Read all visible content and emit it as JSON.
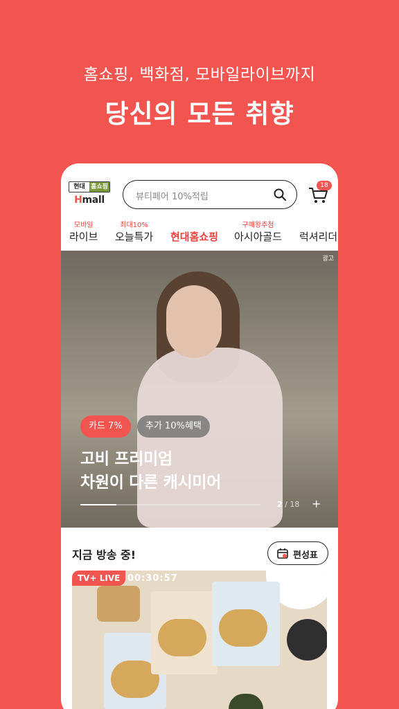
{
  "promo": {
    "subtitle": "홈쇼핑, 백화점, 모바일라이브까지",
    "title": "당신의 모든 취향"
  },
  "header": {
    "logo_top_left": "현대",
    "logo_top_right": "홈쇼핑",
    "logo_h": "H",
    "logo_mall": "mall",
    "search_placeholder": "뷰티페어 10%적립",
    "cart_count": "18"
  },
  "tabs": [
    {
      "sup": "모바일",
      "label": "라이브"
    },
    {
      "sup": "최대10%",
      "label": "오늘특가"
    },
    {
      "sup": "",
      "label": "현대홈쇼핑"
    },
    {
      "sup": "구매왕추첨",
      "label": "아시아골드"
    },
    {
      "sup": "",
      "label": "럭셔리더"
    }
  ],
  "banner": {
    "ad_label": "광고",
    "badge_card": "카드 7%",
    "badge_extra": "추가 10%혜택",
    "title_line1": "고비 프리미엄",
    "title_line2": "차원이 다른 캐시미어",
    "page_current": "2",
    "page_total": "/ 18",
    "plus": "+",
    "progress": 0.2
  },
  "live": {
    "section_title": "지금 방송 중!",
    "schedule_label": "편성표",
    "live_badge": "TV+ LIVE",
    "timer": "00:30:57"
  },
  "colors": {
    "brand": "#f2544f",
    "text": "#222222"
  }
}
